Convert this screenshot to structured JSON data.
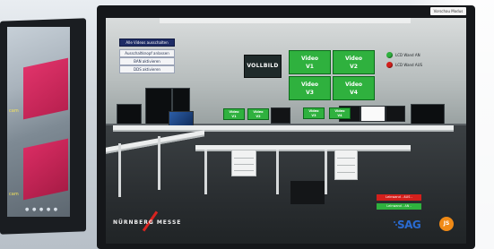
{
  "bezel": {
    "label": "Vorschau Modus"
  },
  "menu": {
    "items": [
      {
        "label": "Alle Videos ausschalten",
        "active": true
      },
      {
        "label": "Ausschaltknopf anlassen",
        "active": false
      },
      {
        "label": "BAN aktivieren",
        "active": false
      },
      {
        "label": "DDS aktivieren",
        "active": false
      }
    ]
  },
  "vollbild": {
    "label": "VOLLBILD"
  },
  "video_wall": {
    "tiles": [
      {
        "line1": "Video",
        "line2": "V1"
      },
      {
        "line1": "Video",
        "line2": "V2"
      },
      {
        "line1": "Video",
        "line2": "V3"
      },
      {
        "line1": "Video",
        "line2": "V4"
      }
    ]
  },
  "desk_buttons": [
    {
      "line1": "Video",
      "line2": "V1"
    },
    {
      "line1": "Video",
      "line2": "V2"
    },
    {
      "line1": "Video",
      "line2": "V3"
    },
    {
      "line1": "Video",
      "line2": "V4"
    }
  ],
  "lcd": {
    "on": {
      "label": "LCD Wand AN",
      "color": "#2fb13e"
    },
    "off": {
      "label": "LCD Wand AUS",
      "color": "#d3201c"
    }
  },
  "controls": {
    "red_label": "Leinwand - AUS -",
    "green_label": "Leinwand - AN -"
  },
  "branding": {
    "left_logo": "NÜRNBERG MESSE",
    "sag_logo": "SAG",
    "round_logo": "JS"
  },
  "colors": {
    "accent_green": "#2fb13e",
    "accent_red": "#d3201c",
    "menu_active": "#1e2c66"
  }
}
